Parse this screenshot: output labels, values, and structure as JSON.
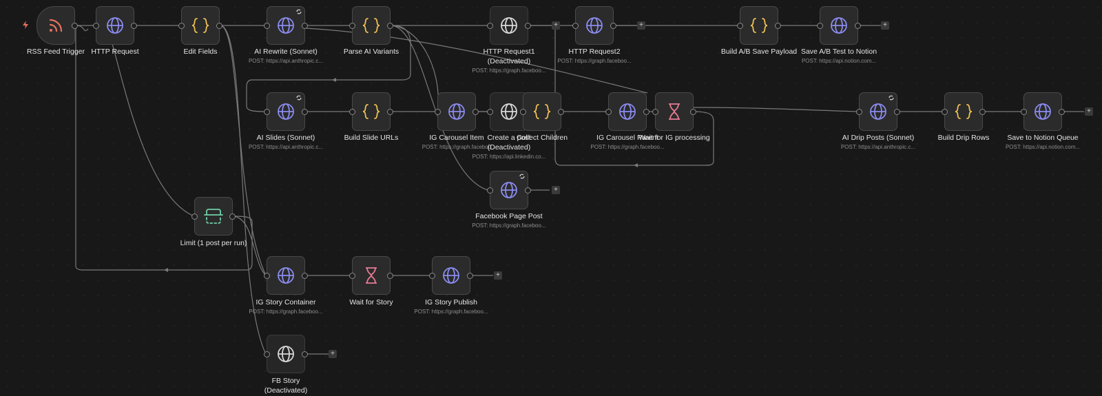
{
  "colors": {
    "background": "#181818",
    "node_fill": "#2b2b2b",
    "node_border": "#4a4a4a",
    "wire": "#7a7a7a",
    "http_icon": "#8b8cf0",
    "code_icon": "#f0c050",
    "rss_icon": "#e8735f",
    "wait_icon": "#e87b95",
    "limit_icon": "#6fd0a7",
    "deactivated_icon": "#d9d9d9"
  },
  "nodes": {
    "rss_feed_trigger": {
      "label": "RSS Feed Trigger",
      "icon": "rss-icon"
    },
    "http_request": {
      "label": "HTTP Request",
      "icon": "globe-icon"
    },
    "edit_fields": {
      "label": "Edit Fields",
      "icon": "braces-icon"
    },
    "ai_rewrite": {
      "label": "AI Rewrite (Sonnet)",
      "sub": "POST: https://api.anthropic.c...",
      "icon": "globe-icon"
    },
    "parse_ai_variants": {
      "label": "Parse AI Variants",
      "icon": "braces-icon"
    },
    "http_request1": {
      "label": "HTTP Request1",
      "label2": "(Deactivated)",
      "sub": "POST: https://graph.faceboo...",
      "icon": "globe-icon"
    },
    "http_request2": {
      "label": "HTTP Request2",
      "sub": "POST: https://graph.faceboo...",
      "icon": "globe-icon"
    },
    "build_ab_save_payload": {
      "label": "Build A/B Save Payload",
      "icon": "braces-icon"
    },
    "save_ab_test_notion": {
      "label": "Save A/B Test to Notion",
      "sub": "POST: https://api.notion.com...",
      "icon": "globe-icon"
    },
    "ai_slides": {
      "label": "AI Slides (Sonnet)",
      "sub": "POST: https://api.anthropic.c...",
      "icon": "globe-icon"
    },
    "build_slide_urls": {
      "label": "Build Slide URLs",
      "icon": "braces-icon"
    },
    "ig_carousel_item": {
      "label": "IG Carousel Item",
      "sub": "POST: https://graph.faceboo",
      "icon": "globe-icon"
    },
    "create_a_post": {
      "label": "Create a post",
      "label2": "(Deactivated)",
      "sub": "POST: https://api.linkedin.co...",
      "icon": "globe-icon"
    },
    "collect_children": {
      "label": "Collect Children",
      "icon": "braces-icon"
    },
    "ig_carousel_parent": {
      "label": "IG Carousel Parent",
      "sub": "POST: https://graph.faceboo...",
      "icon": "globe-icon"
    },
    "wait_ig_processing": {
      "label": "Wait for IG processing",
      "icon": "hourglass-icon"
    },
    "ai_drip_posts": {
      "label": "AI Drip Posts (Sonnet)",
      "sub": "POST: https://api.anthropic.c...",
      "icon": "globe-icon"
    },
    "build_drip_rows": {
      "label": "Build Drip Rows",
      "icon": "braces-icon"
    },
    "save_notion_queue": {
      "label": "Save to Notion Queue",
      "sub": "POST: https://api.notion.com...",
      "icon": "globe-icon"
    },
    "facebook_page_post": {
      "label": "Facebook Page Post",
      "sub": "POST: https://graph.faceboo...",
      "icon": "globe-icon"
    },
    "limit": {
      "label": "Limit (1 post per run)",
      "icon": "limit-icon"
    },
    "ig_story_container": {
      "label": "IG Story Container",
      "sub": "POST: https://graph.faceboo...",
      "icon": "globe-icon"
    },
    "wait_for_story": {
      "label": "Wait for Story",
      "icon": "hourglass-icon"
    },
    "ig_story_publish": {
      "label": "IG Story Publish",
      "sub": "POST: https://graph.faceboo...",
      "icon": "globe-icon"
    },
    "fb_story": {
      "label": "FB Story",
      "label2": "(Deactivated)",
      "icon": "globe-icon"
    }
  },
  "add_button_label": "+"
}
